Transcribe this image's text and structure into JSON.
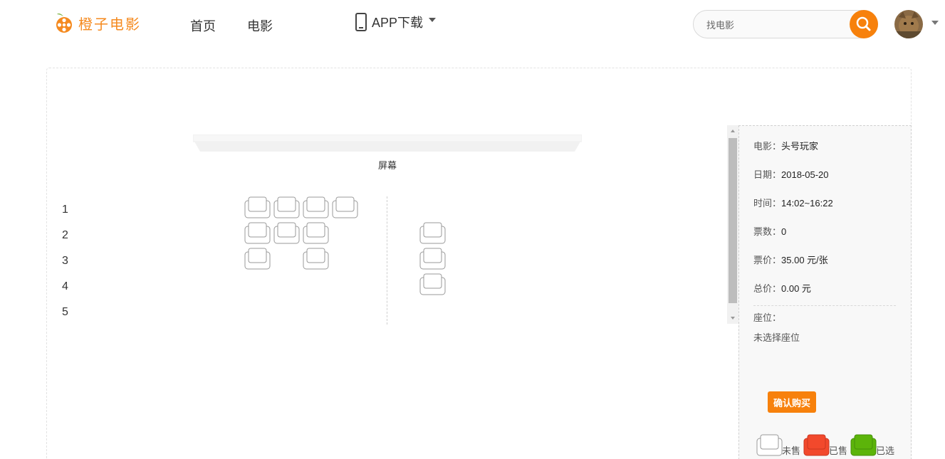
{
  "header": {
    "logo_text": "橙子电影",
    "nav": [
      {
        "label": "首页"
      },
      {
        "label": "电影"
      }
    ],
    "app_download": "APP下载",
    "search_placeholder": "找电影"
  },
  "screen_label": "屏幕",
  "seat_rows": [
    "1",
    "2",
    "3",
    "4",
    "5"
  ],
  "info": {
    "movie_label": "电影：",
    "movie_value": "头号玩家",
    "date_label": "日期：",
    "date_value": "2018-05-20",
    "time_label": "时间：",
    "time_value": "14:02~16:22",
    "count_label": "票数：",
    "count_value": "0",
    "price_label": "票价：",
    "price_value": "35.00 元/张",
    "total_label": "总价：",
    "total_value": "0.00 元",
    "seat_label": "座位：",
    "seat_value": "未选择座位",
    "buy_button": "确认购买"
  },
  "legend": [
    {
      "label": "未售",
      "color": "#ffffff"
    },
    {
      "label": "已售",
      "color": "#f2492c"
    },
    {
      "label": "已选",
      "color": "#5cb40a"
    }
  ],
  "colors": {
    "accent": "#f7810c",
    "seat_border": "#999999"
  }
}
